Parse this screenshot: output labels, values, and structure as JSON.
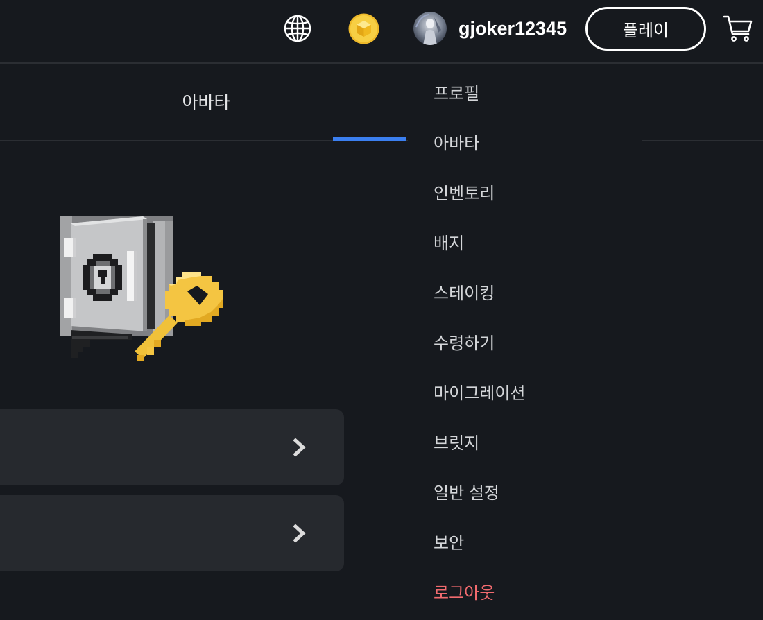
{
  "header": {
    "language_icon": "globe-icon",
    "coin_icon": "coin-icon",
    "avatar_icon": "avatar",
    "username": "gjoker12345",
    "play_button_label": "플레이",
    "cart_icon": "cart-icon"
  },
  "tabs": [
    {
      "label": "아바타"
    }
  ],
  "illustration": "safe-with-key-illustration",
  "cards": [
    {
      "icon": "chevron-right-icon"
    },
    {
      "icon": "chevron-right-icon"
    }
  ],
  "user_menu": {
    "items": [
      {
        "label": "프로필"
      },
      {
        "label": "아바타"
      },
      {
        "label": "인벤토리"
      },
      {
        "label": "배지"
      },
      {
        "label": "스테이킹"
      },
      {
        "label": "수령하기"
      },
      {
        "label": "마이그레이션"
      },
      {
        "label": "브릿지"
      },
      {
        "label": "일반 설정"
      },
      {
        "label": "보안"
      },
      {
        "label": "로그아웃"
      }
    ]
  },
  "colors": {
    "background": "#16191e",
    "divider": "#2b2e33",
    "accent": "#3b7ff0",
    "card": "#26292e",
    "menu_text": "#d4d6d9",
    "logout": "#f26b6f",
    "coin": "#f5c83c"
  }
}
